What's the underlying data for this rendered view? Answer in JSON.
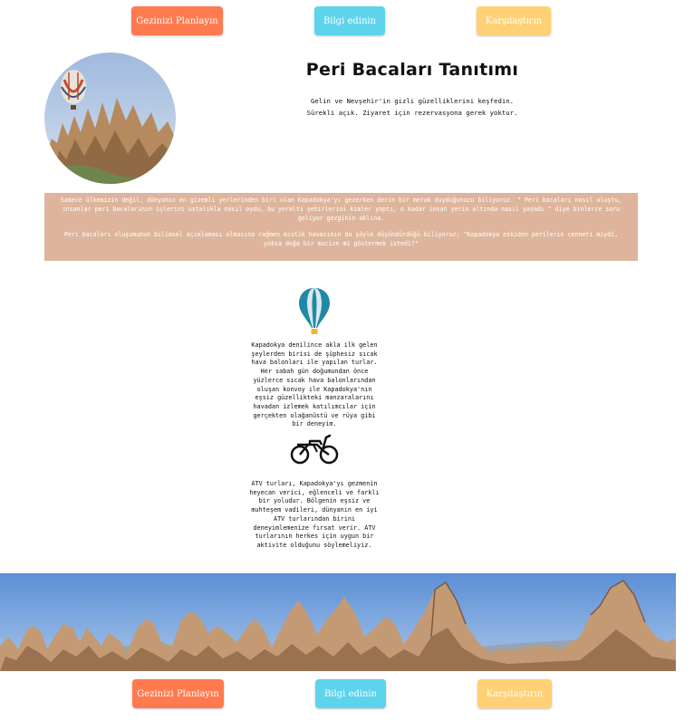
{
  "nav_top": {
    "plan_label": "Gezinizi Planlayın",
    "info_label": "Bilgi edinin",
    "compare_label": "Karşılaştırın"
  },
  "hero": {
    "title": "Peri Bacaları Tanıtımı",
    "intro_line1": "Gelin ve Nevşehir'in gizli güzelliklerini keşfedin.",
    "intro_line2": "Sürekli açık. Ziyaret için rezervasyona gerek yoktur."
  },
  "story": {
    "paragraph1": "Sadece ülkemizin değil, dünyanın en gizemli yerlerinden biri olan Kapadokya'yı gezerken derin bir merak duyduğunuzu biliyoruz. \" Peri bacaları nasıl oluştu, insanlar peri bacalarının içlerini ustalıkla nasıl oydu, bu yeraltı şehirlerini kimler yaptı, o kadar insan yerin altında nasıl yaşadı \" diye binlerce soru geliyor gezginin aklına.",
    "paragraph2": "Peri bacaları oluşumunun bilimsel açıklaması olmasına rağmen mistik havasının da şöyle düşündürdüğü biliyoruz; \"Kapadokya eskiden perilerin cenneti miydi, yoksa doğa bir mucize mi göstermek istedi?\""
  },
  "features": {
    "balloon_icon": "hot-air-balloon-icon",
    "balloon_text": "Kapadokya denilince akla ilk gelen şeylerden birisi de şüphesiz sıcak hava balonları ile yapılan turlar. Her sabah gün doğumundan önce yüzlerce sıcak hava balonlarından oluşan konvoy ile Kapadokya'nın eşsiz güzellikteki manzaralarını havadan izlemek katılımcılar için gerçekten olağanüstü ve rüya gibi bir deneyim.",
    "atv_icon": "motorcycle-icon",
    "atv_text": "ATV turları, Kapadokya'yı gezmenin heyecan verici, eğlenceli ve farklı bir yoludur. Bölgenin eşsiz ve muhteşem vadileri, dünyanın en iyi ATV turlarından birini deneyimlemenize fırsat verir. ATV turlarının herkes için uygun bir aktivite olduğunu söylemeliyiz."
  },
  "nav_bottom": {
    "plan_label": "Gezinizi Planlayın",
    "info_label": "Bilgi edinin",
    "compare_label": "Karşılaştırın"
  },
  "colors": {
    "plan": "#ff7a4f",
    "info": "#5dd3ec",
    "compare": "#ffd174",
    "story_bg": "#deb59c"
  }
}
